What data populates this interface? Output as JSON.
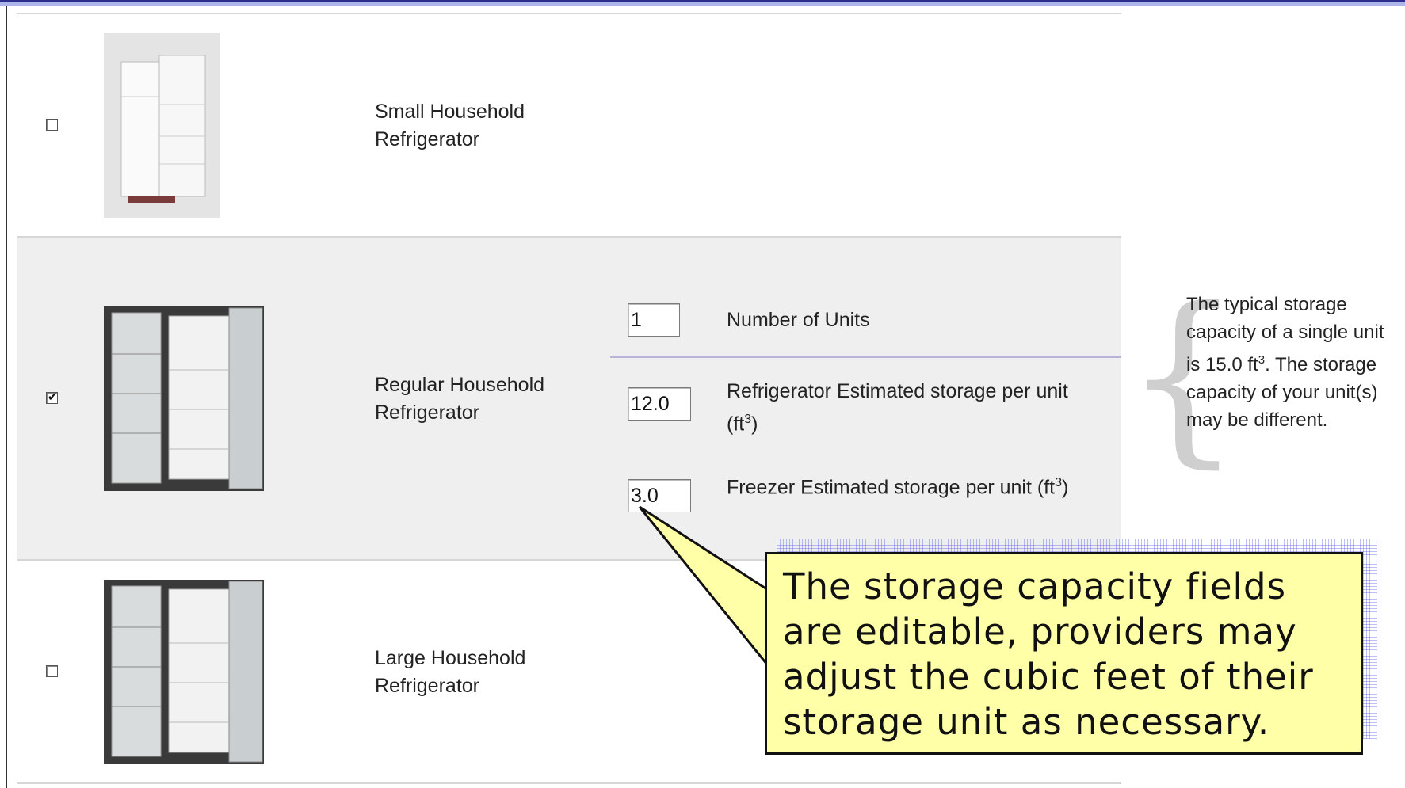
{
  "rows": [
    {
      "label": "Small Household Refrigerator",
      "checked": false,
      "image": "small-fridge-image"
    },
    {
      "label": "Regular Household Refrigerator",
      "checked": true,
      "image": "regular-fridge-image"
    },
    {
      "label": "Large Household Refrigerator",
      "checked": false,
      "image": "large-fridge-image"
    }
  ],
  "fields": {
    "units_value": "1",
    "units_label": "Number of Units",
    "fridge_value": "12.0",
    "fridge_label": "Refrigerator Estimated storage per unit (ft",
    "freezer_value": "3.0",
    "freezer_label": "Freezer Estimated storage per unit (ft",
    "unit_sup": "3",
    "unit_close": ")"
  },
  "note": {
    "text_a": "The typical storage capacity of a single unit is 15.0 ft",
    "sup": "3",
    "text_b": ". The storage capacity of your unit(s) may be different."
  },
  "callout": {
    "text": "The storage capacity fields are editable, providers may adjust the cubic feet of their storage unit as necessary."
  },
  "colors": {
    "callout_bg": "#ffffa8",
    "row_highlight": "#efefef",
    "frame_blue": "#2d2d8f"
  }
}
